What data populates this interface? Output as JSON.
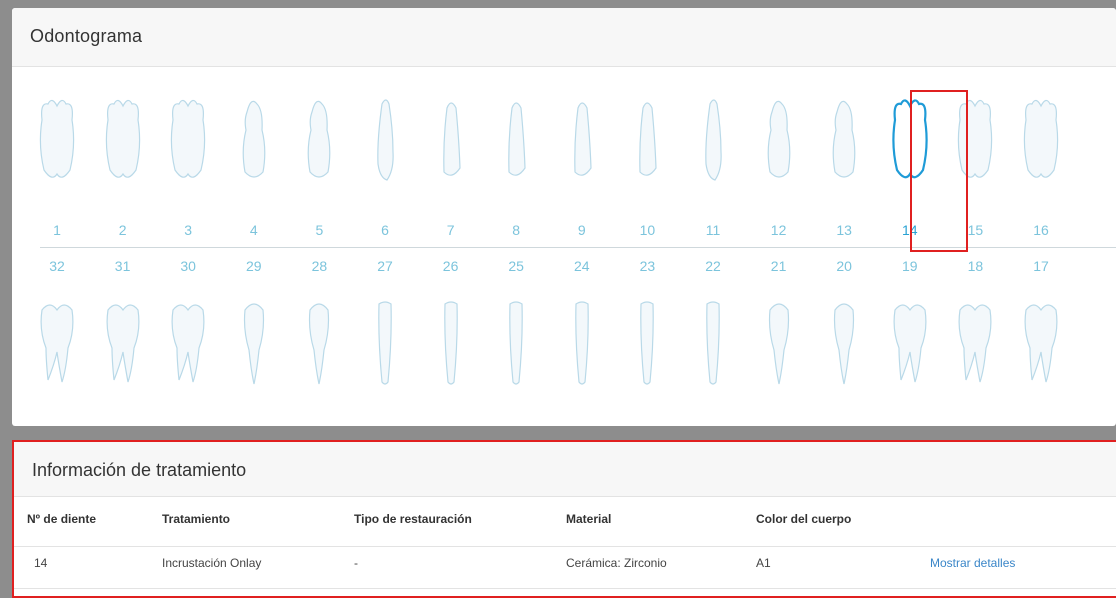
{
  "odontogram": {
    "title": "Odontograma",
    "upper_numbers": [
      "1",
      "2",
      "3",
      "4",
      "5",
      "6",
      "7",
      "8",
      "9",
      "10",
      "11",
      "12",
      "13",
      "14",
      "15",
      "16"
    ],
    "lower_numbers": [
      "32",
      "31",
      "30",
      "29",
      "28",
      "27",
      "26",
      "25",
      "24",
      "23",
      "22",
      "21",
      "20",
      "19",
      "18",
      "17"
    ],
    "selected_tooth": "14",
    "colors": {
      "tooth_outline": "#b9d9e8",
      "selected_outline": "#1f9bd7",
      "number": "#7cc4dc",
      "highlight": "#e02020"
    }
  },
  "treatment": {
    "title": "Información de tratamiento",
    "columns": [
      "Nº de diente",
      "Tratamiento",
      "Tipo de restauración",
      "Material",
      "Color del cuerpo"
    ],
    "rows": [
      {
        "tooth": "14",
        "treatment": "Incrustación Onlay",
        "restoration": "-",
        "material": "Cerámica: Zirconio",
        "shade": "A1",
        "action": "Mostrar detalles"
      }
    ]
  }
}
